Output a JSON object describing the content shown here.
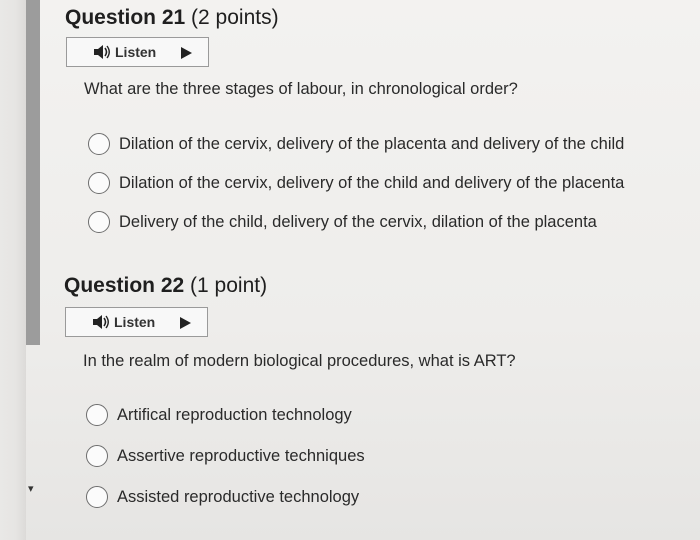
{
  "q21": {
    "title_num": "Question 21",
    "title_pts": "(2 points)",
    "listen_label": "Listen",
    "prompt": "What are the three stages of labour, in chronological order?",
    "options": [
      "Dilation of the cervix, delivery of the placenta and delivery of the child",
      "Dilation of the cervix, delivery of the child and delivery of the placenta",
      "Delivery of the child, delivery of the cervix, dilation of the placenta"
    ]
  },
  "q22": {
    "title_num": "Question 22",
    "title_pts": "(1 point)",
    "listen_label": "Listen",
    "prompt": "In the realm of modern biological procedures, what is ART?",
    "options": [
      "Artifical reproduction technology",
      "Assertive reproductive techniques",
      "Assisted reproductive technology"
    ]
  },
  "icons": {
    "speaker": "speaker-icon",
    "play": "play-icon"
  }
}
